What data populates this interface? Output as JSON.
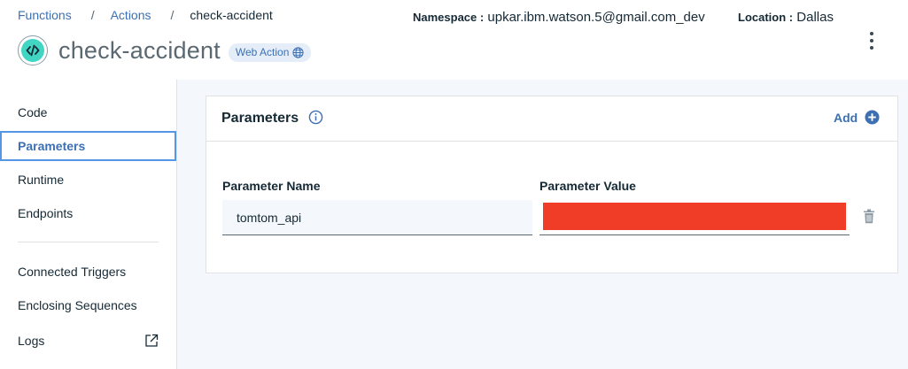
{
  "breadcrumb": {
    "items": [
      "Functions",
      "Actions"
    ],
    "separator": "/",
    "current": "check-accident"
  },
  "action": {
    "name": "check-accident",
    "badge": "Web Action",
    "icon": "code-icon"
  },
  "namespace": {
    "label": "Namespace :",
    "value": "upkar.ibm.watson.5@gmail.com_dev"
  },
  "location": {
    "label": "Location :",
    "value": "Dallas"
  },
  "sidebar": {
    "items": [
      {
        "label": "Code",
        "active": false
      },
      {
        "label": "Parameters",
        "active": true
      },
      {
        "label": "Runtime",
        "active": false
      },
      {
        "label": "Endpoints",
        "active": false
      },
      {
        "label": "Connected Triggers",
        "active": false
      },
      {
        "label": "Enclosing Sequences",
        "active": false
      },
      {
        "label": "Logs",
        "active": false,
        "icon": "external-link-icon"
      }
    ]
  },
  "parameters": {
    "title": "Parameters",
    "add_label": "Add",
    "name_header": "Parameter Name",
    "value_header": "Parameter Value",
    "rows": [
      {
        "name": "tomtom_api",
        "value_redacted": true
      }
    ]
  },
  "colors": {
    "link": "#3d70b2",
    "accent_teal": "#41d6c3",
    "active_border": "#5596e6",
    "redaction": "#ef3d27",
    "panel_bg": "#f4f7fb"
  }
}
